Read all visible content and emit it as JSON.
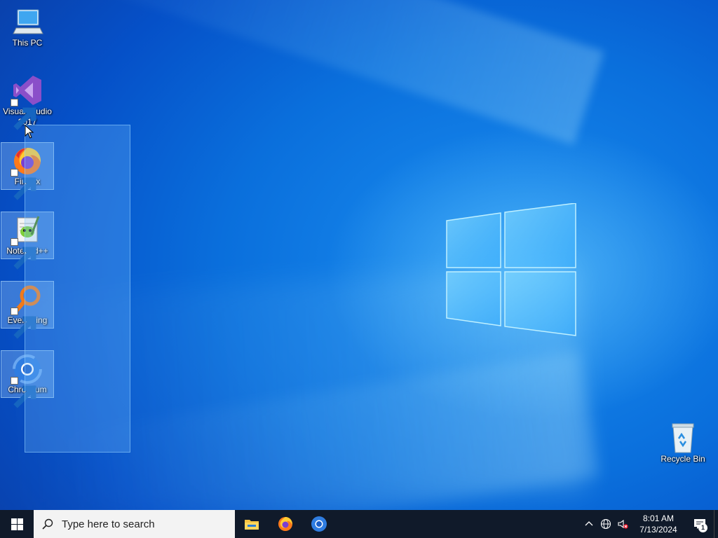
{
  "desktop": {
    "icons": [
      {
        "label": "This PC",
        "icon": "this-pc-icon"
      },
      {
        "label": "Visual Studio 2017",
        "icon": "visual-studio-icon"
      },
      {
        "label": "Firefox",
        "icon": "firefox-icon"
      },
      {
        "label": "Notepad++",
        "icon": "notepad-plus-plus-icon"
      },
      {
        "label": "Everything",
        "icon": "everything-search-icon"
      },
      {
        "label": "Chromium",
        "icon": "chromium-icon"
      },
      {
        "label": "Recycle Bin",
        "icon": "recycle-bin-icon"
      }
    ]
  },
  "taskbar": {
    "search_placeholder": "Type here to search",
    "pinned_apps": [
      "file-explorer-icon",
      "firefox-icon",
      "chromium-icon"
    ],
    "clock": {
      "time": "8:01 AM",
      "date": "7/13/2024"
    },
    "notification_count": "1"
  },
  "colors": {
    "taskbar_bg": "#101a2a",
    "desktop_accent": "#0a6fdc"
  }
}
